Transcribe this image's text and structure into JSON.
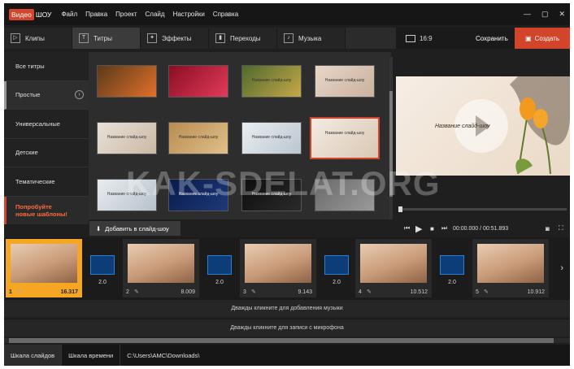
{
  "app": {
    "logo_part1": "Видео",
    "logo_part2": "ШОУ",
    "menu": [
      "Файл",
      "Правка",
      "Проект",
      "Слайд",
      "Настройки",
      "Справка"
    ],
    "window_controls": [
      "—",
      "▢",
      "✕"
    ]
  },
  "tabs": [
    {
      "label": "Клипы",
      "icon": "clips-icon"
    },
    {
      "label": "Титры",
      "icon": "titles-icon",
      "active": true
    },
    {
      "label": "Эффекты",
      "icon": "effects-icon"
    },
    {
      "label": "Переходы",
      "icon": "transitions-icon"
    },
    {
      "label": "Музыка",
      "icon": "music-icon"
    }
  ],
  "right_toolbar": {
    "ratio": "16:9",
    "save": "Сохранить",
    "create": "Создать"
  },
  "categories": [
    {
      "label": "Все титры"
    },
    {
      "label": "Простые",
      "active": true
    },
    {
      "label": "Универсальные"
    },
    {
      "label": "Детские"
    },
    {
      "label": "Тематические"
    }
  ],
  "promo": {
    "line1": "Попробуйте",
    "line2": "новые шаблоны!"
  },
  "thumbnails": [
    {
      "colors": [
        "#5a3a1a",
        "#e2702a"
      ],
      "text": ""
    },
    {
      "colors": [
        "#8a0e22",
        "#e23a5a"
      ],
      "text": ""
    },
    {
      "colors": [
        "#4e6a2e",
        "#c7a848"
      ],
      "text": "Название слайд-шоу"
    },
    {
      "colors": [
        "#e8d6c8",
        "#c9b29e"
      ],
      "text": "Название слайд-шоу"
    },
    {
      "colors": [
        "#e8e1d8",
        "#cbb8a4"
      ],
      "text": "Название слайд-шоу"
    },
    {
      "colors": [
        "#b98c52",
        "#e0c08a"
      ],
      "text": "Название слайд-шоу"
    },
    {
      "colors": [
        "#e9eef2",
        "#bcc6cf"
      ],
      "text": "Название слайд-шоу"
    },
    {
      "colors": [
        "#f3ebe2",
        "#d9c8b4"
      ],
      "text": "Название слайд-шоу",
      "selected": true
    },
    {
      "colors": [
        "#e8ecf0",
        "#b8c2cc"
      ],
      "text": "Название слайд-шоу"
    },
    {
      "colors": [
        "#081a4a",
        "#1e3a7a"
      ],
      "text": "Название слайд-шоу"
    },
    {
      "colors": [
        "#0e0e0e",
        "#2a2a2a"
      ],
      "text": "Название слайд-шоу"
    },
    {
      "colors": [
        "#6a6a6a",
        "#9a9a9a"
      ],
      "text": ""
    }
  ],
  "add_button": "Добавить в слайд-шоу",
  "preview": {
    "title_text": "Название слайд-шоу"
  },
  "player": {
    "time": "00:00.000 / 00:51.893"
  },
  "slides": [
    {
      "num": "1",
      "duration": "16.317",
      "active": true
    },
    {
      "num": "2",
      "duration": "8.009"
    },
    {
      "num": "3",
      "duration": "9.143"
    },
    {
      "num": "4",
      "duration": "10.512"
    },
    {
      "num": "5",
      "duration": "10.912"
    }
  ],
  "transitions": [
    "2.0",
    "2.0",
    "2.0",
    "2.0"
  ],
  "tracks": {
    "music": "Дважды кликните для добавления музыки",
    "mic": "Дважды кликните для записи с микрофона"
  },
  "status": {
    "tab_slides": "Шкала слайдов",
    "tab_timeline": "Шкала времени",
    "path": "C:\\Users\\AMC\\Downloads\\"
  },
  "watermark": "KAK-SDELAT.ORG",
  "colors": {
    "accent": "#d2452a",
    "slide_active": "#f5a623",
    "transition": "#0d3d78"
  }
}
